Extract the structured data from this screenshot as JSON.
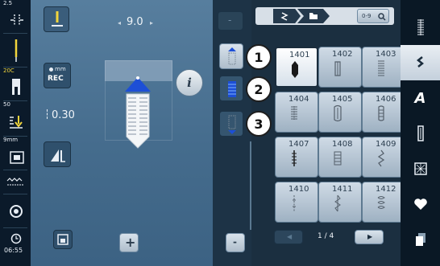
{
  "left_status": {
    "stitch_width_value": "2.5",
    "needle_label": "",
    "presser_foot_label": "20C",
    "thread_tension_value": "50",
    "buttonhole_size": "9mm",
    "clock_time": "06:55"
  },
  "main": {
    "stitch_length_value": "9.0",
    "rec_label": "REC",
    "rec_mm": "mm",
    "counter_value": "0.30",
    "info_icon_label": "i",
    "add_label": "+"
  },
  "midstrip": {
    "minus_label": "-"
  },
  "stitch_panel": {
    "search_label": "0-9",
    "pager_text": "1 / 4",
    "stitches": [
      {
        "number": "1401",
        "selected": true
      },
      {
        "number": "1402",
        "selected": false
      },
      {
        "number": "1403",
        "selected": false
      },
      {
        "number": "1404",
        "selected": false
      },
      {
        "number": "1405",
        "selected": false
      },
      {
        "number": "1406",
        "selected": false
      },
      {
        "number": "1407",
        "selected": false
      },
      {
        "number": "1408",
        "selected": false
      },
      {
        "number": "1409",
        "selected": false
      },
      {
        "number": "1410",
        "selected": false
      },
      {
        "number": "1411",
        "selected": false
      },
      {
        "number": "1412",
        "selected": false
      }
    ]
  },
  "callouts": [
    "1",
    "2",
    "3"
  ],
  "side_tabs": {
    "alphabet_label": "A"
  },
  "colors": {
    "accent_blue": "#1d4fd6",
    "yellow": "#f2d53c",
    "panel_blue": "#4a7192"
  }
}
